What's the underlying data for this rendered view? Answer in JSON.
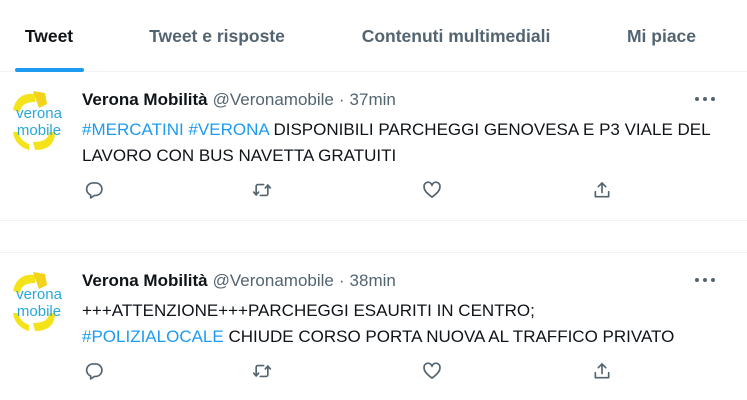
{
  "tabs": [
    {
      "label": "Tweet",
      "active": true
    },
    {
      "label": "Tweet e risposte",
      "active": false
    },
    {
      "label": "Contenuti multimediali",
      "active": false
    },
    {
      "label": "Mi piace",
      "active": false
    }
  ],
  "tweets": [
    {
      "name": "Verona Mobilità",
      "handle": "@Veronamobile",
      "separator": "·",
      "time": "37min",
      "segments": [
        {
          "text": "#MERCATINI",
          "hashtag": true
        },
        {
          "text": " ",
          "hashtag": false
        },
        {
          "text": "#VERONA",
          "hashtag": true
        },
        {
          "text": " DISPONIBILI PARCHEGGI GENOVESA E P3 VIALE DEL LAVORO CON BUS NAVETTA GRATUITI",
          "hashtag": false
        }
      ]
    },
    {
      "name": "Verona Mobilità",
      "handle": "@Veronamobile",
      "separator": "·",
      "time": "38min",
      "segments": [
        {
          "text": "+++ATTENZIONE+++PARCHEGGI ESAURITI IN CENTRO;",
          "hashtag": false
        },
        {
          "text": "\n",
          "hashtag": false
        },
        {
          "text": "#POLIZIALOCALE",
          "hashtag": true
        },
        {
          "text": " CHIUDE CORSO PORTA NUOVA AL TRAFFICO PRIVATO",
          "hashtag": false
        }
      ]
    }
  ],
  "avatar": {
    "line1": "verona",
    "line2": "mobile",
    "colors": {
      "yellow": "#f5e31a",
      "blue": "#29a8d8",
      "ring": "#f2d21a"
    }
  },
  "icons": {
    "reply": "reply-icon",
    "retweet": "retweet-icon",
    "like": "like-icon",
    "share": "share-icon",
    "more": "more-icon"
  },
  "colors": {
    "accent": "#1d9bf0",
    "text": "#0f1419",
    "secondary": "#536471",
    "border": "#eff3f4"
  }
}
